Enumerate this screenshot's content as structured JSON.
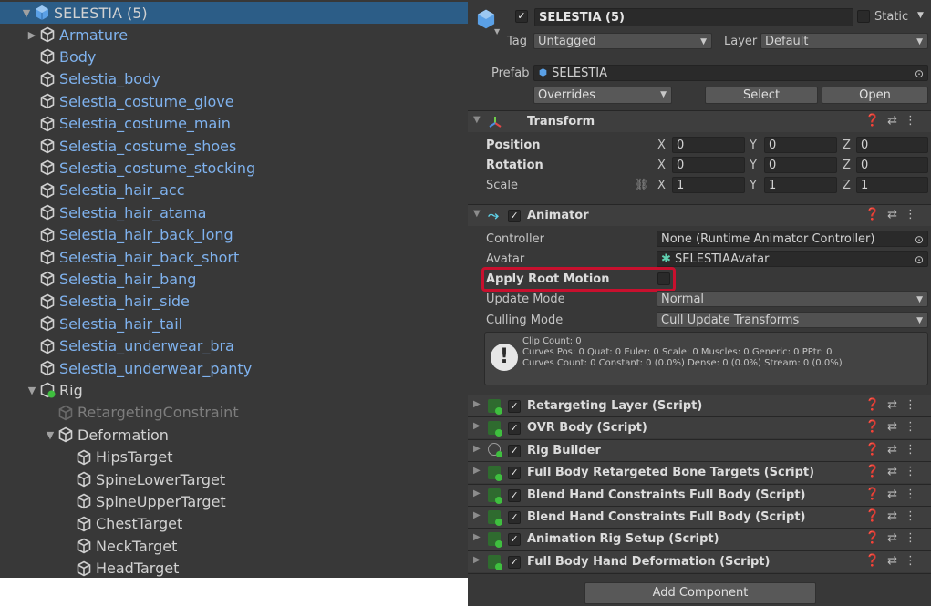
{
  "hierarchy": {
    "root": "SELESTIA (5)",
    "items": [
      {
        "label": "Armature"
      },
      {
        "label": "Body"
      },
      {
        "label": "Selestia_body"
      },
      {
        "label": "Selestia_costume_glove"
      },
      {
        "label": "Selestia_costume_main"
      },
      {
        "label": "Selestia_costume_shoes"
      },
      {
        "label": "Selestia_costume_stocking"
      },
      {
        "label": "Selestia_hair_acc"
      },
      {
        "label": "Selestia_hair_atama"
      },
      {
        "label": "Selestia_hair_back_long"
      },
      {
        "label": "Selestia_hair_back_short"
      },
      {
        "label": "Selestia_hair_bang"
      },
      {
        "label": "Selestia_hair_side"
      },
      {
        "label": "Selestia_hair_tail"
      },
      {
        "label": "Selestia_underwear_bra"
      },
      {
        "label": "Selestia_underwear_panty"
      },
      {
        "label": "Rig"
      },
      {
        "label": "RetargetingConstraint"
      },
      {
        "label": "Deformation"
      },
      {
        "label": "HipsTarget"
      },
      {
        "label": "SpineLowerTarget"
      },
      {
        "label": "SpineUpperTarget"
      },
      {
        "label": "ChestTarget"
      },
      {
        "label": "NeckTarget"
      },
      {
        "label": "HeadTarget"
      }
    ]
  },
  "inspector": {
    "object_name": "SELESTIA (5)",
    "static_label": "Static",
    "tag_label": "Tag",
    "tag_value": "Untagged",
    "layer_label": "Layer",
    "layer_value": "Default",
    "prefab_label": "Prefab",
    "prefab_value": "SELESTIA",
    "overrides_label": "Overrides",
    "select_label": "Select",
    "open_label": "Open",
    "transform": {
      "title": "Transform",
      "position_label": "Position",
      "rotation_label": "Rotation",
      "scale_label": "Scale",
      "axis_x": "X",
      "axis_y": "Y",
      "axis_z": "Z",
      "position": {
        "x": "0",
        "y": "0",
        "z": "0"
      },
      "rotation": {
        "x": "0",
        "y": "0",
        "z": "0"
      },
      "scale": {
        "x": "1",
        "y": "1",
        "z": "1"
      }
    },
    "animator": {
      "title": "Animator",
      "controller_label": "Controller",
      "controller_value": "None (Runtime Animator Controller)",
      "avatar_label": "Avatar",
      "avatar_value": "SELESTIAAvatar",
      "apply_root_motion_label": "Apply Root Motion",
      "update_mode_label": "Update Mode",
      "update_mode_value": "Normal",
      "culling_mode_label": "Culling Mode",
      "culling_mode_value": "Cull Update Transforms",
      "info_line1": "Clip Count: 0",
      "info_line2": "Curves Pos: 0 Quat: 0 Euler: 0 Scale: 0 Muscles: 0 Generic: 0 PPtr: 0",
      "info_line3": "Curves Count: 0 Constant: 0 (0.0%) Dense: 0 (0.0%) Stream: 0 (0.0%)"
    },
    "components": [
      {
        "title": "Retargeting Layer (Script)"
      },
      {
        "title": "OVR Body (Script)"
      },
      {
        "title": "Rig Builder"
      },
      {
        "title": "Full Body Retargeted Bone Targets (Script)"
      },
      {
        "title": "Blend Hand Constraints Full Body (Script)"
      },
      {
        "title": "Blend Hand Constraints Full Body (Script)"
      },
      {
        "title": "Animation Rig Setup (Script)"
      },
      {
        "title": "Full Body Hand Deformation (Script)"
      }
    ],
    "add_component_label": "Add Component"
  },
  "colors": {
    "highlight_box": "#c8102e",
    "selection": "#2c5d87",
    "prefab_blue": "#7fb2ee"
  }
}
